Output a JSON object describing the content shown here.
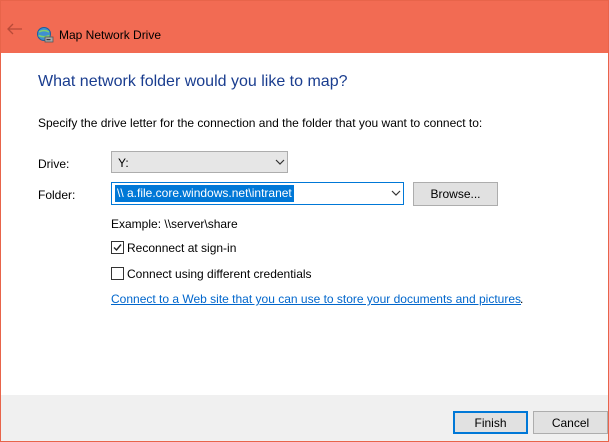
{
  "window": {
    "title": "Map Network Drive",
    "titlebar_color": "#f26b53"
  },
  "heading": "What network folder would you like to map?",
  "description": "Specify the drive letter for the connection and the folder that you want to connect to:",
  "drive": {
    "label": "Drive:",
    "value": "Y:"
  },
  "folder": {
    "label": "Folder:",
    "value": "\\\\        a.file.core.windows.net\\intranet",
    "browse_label": "Browse...",
    "example": "Example: \\\\server\\share"
  },
  "options": {
    "reconnect": {
      "label": "Reconnect at sign-in",
      "checked": true
    },
    "different_credentials": {
      "label": "Connect using different credentials",
      "checked": false
    }
  },
  "link": {
    "text": "Connect to a Web site that you can use to store your documents and pictures",
    "suffix": "."
  },
  "buttons": {
    "finish": "Finish",
    "cancel": "Cancel"
  },
  "icons": {
    "back": "back-arrow-icon",
    "app": "network-drive-icon",
    "dropdown": "chevron-down-icon",
    "check": "checkmark-icon"
  }
}
